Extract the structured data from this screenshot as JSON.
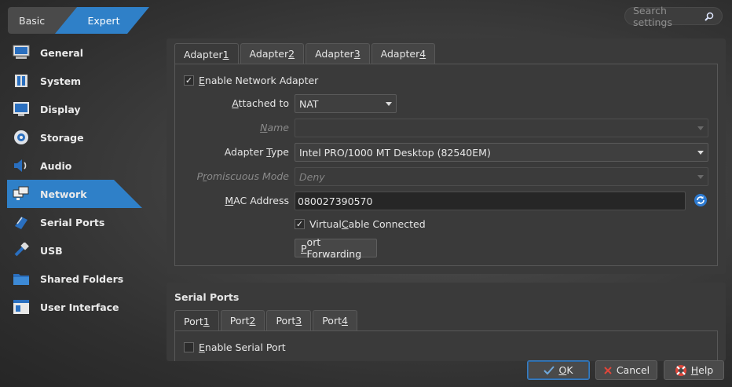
{
  "mode": {
    "basic": "Basic",
    "expert": "Expert"
  },
  "search": {
    "placeholder": "Search settings"
  },
  "sidebar": {
    "items": [
      {
        "label": "General",
        "icon": "monitor-icon"
      },
      {
        "label": "System",
        "icon": "chip-icon"
      },
      {
        "label": "Display",
        "icon": "display-icon"
      },
      {
        "label": "Storage",
        "icon": "disk-icon"
      },
      {
        "label": "Audio",
        "icon": "speaker-icon"
      },
      {
        "label": "Network",
        "icon": "network-icon",
        "selected": true
      },
      {
        "label": "Serial Ports",
        "icon": "serial-plug-icon"
      },
      {
        "label": "USB",
        "icon": "usb-icon"
      },
      {
        "label": "Shared Folders",
        "icon": "folder-icon"
      },
      {
        "label": "User Interface",
        "icon": "window-icon"
      }
    ]
  },
  "network": {
    "tabs": [
      {
        "pre": "Adapter ",
        "key": "1"
      },
      {
        "pre": "Adapter ",
        "key": "2"
      },
      {
        "pre": "Adapter ",
        "key": "3"
      },
      {
        "pre": "Adapter ",
        "key": "4"
      }
    ],
    "enable": {
      "key": "E",
      "rest": "nable Network Adapter",
      "checked": true
    },
    "attached_to": {
      "key": "A",
      "rest": "ttached to",
      "value": "NAT"
    },
    "name": {
      "key": "N",
      "rest": "ame",
      "value": ""
    },
    "adapter_type": {
      "pre": "Adapter ",
      "key": "T",
      "rest": "ype",
      "value": "Intel PRO/1000 MT Desktop (82540EM)"
    },
    "promiscuous": {
      "pre": "P",
      "key": "r",
      "rest": "omiscuous Mode",
      "value": "Deny"
    },
    "mac": {
      "key": "M",
      "rest": "AC Address",
      "value": "080027390570"
    },
    "cable": {
      "pre": "Virtual ",
      "key": "C",
      "rest": "able Connected",
      "checked": true
    },
    "port_forwarding": {
      "key": "P",
      "rest": "ort Forwarding"
    }
  },
  "serial": {
    "title": "Serial Ports",
    "tabs": [
      {
        "pre": "Port ",
        "key": "1"
      },
      {
        "pre": "Port ",
        "key": "2"
      },
      {
        "pre": "Port ",
        "key": "3"
      },
      {
        "pre": "Port ",
        "key": "4"
      }
    ],
    "enable": {
      "key": "E",
      "rest": "nable Serial Port",
      "checked": false
    }
  },
  "buttons": {
    "ok": {
      "key": "O",
      "rest": "K"
    },
    "cancel": {
      "label": "Cancel"
    },
    "help": {
      "key": "H",
      "rest": "elp"
    }
  },
  "colors": {
    "accent": "#2f80c8",
    "background": "#3a3a3a"
  }
}
